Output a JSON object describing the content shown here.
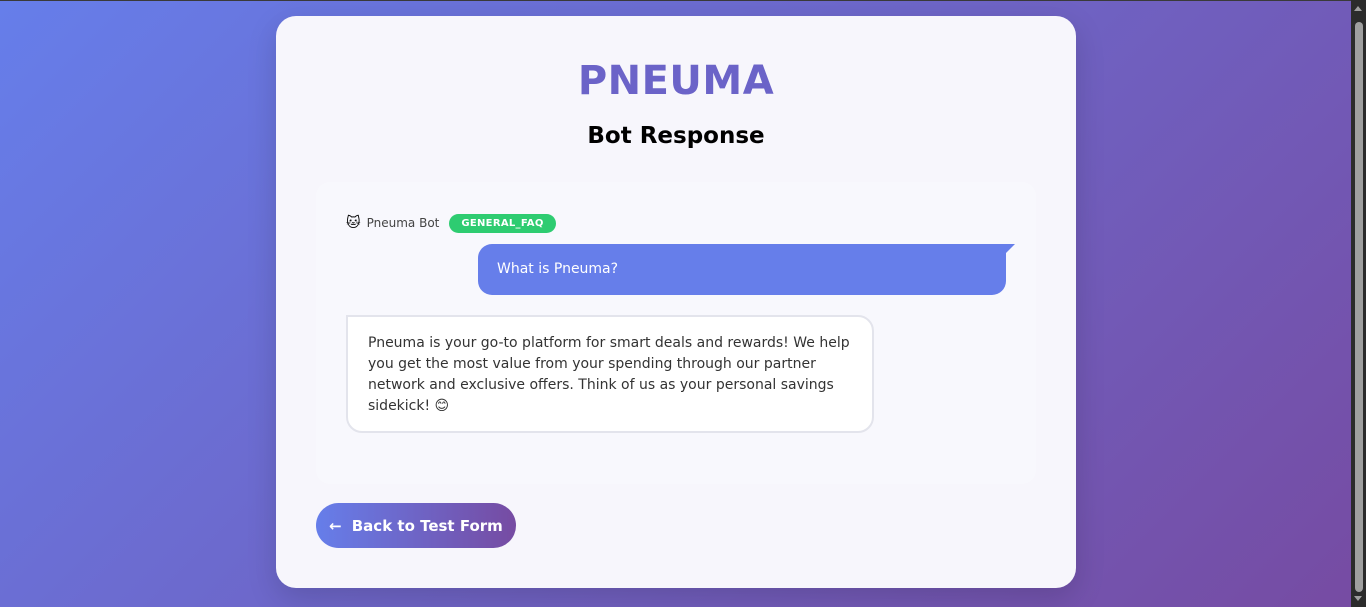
{
  "app": {
    "brand": "PNEUMA",
    "subtitle": "Bot Response"
  },
  "chat": {
    "bot_icon": "🐱",
    "bot_name": "Pneuma Bot",
    "intent": "GENERAL_FAQ",
    "user_message": "What is Pneuma?",
    "bot_message": "Pneuma is your go-to platform for smart deals and rewards! We help you get the most value from your spending through our partner network and exclusive offers. Think of us as your personal savings sidekick! 😊"
  },
  "actions": {
    "back_arrow": "←",
    "back_label": "Back to Test Form"
  },
  "colors": {
    "accent": "#667eea",
    "accent_end": "#764ba2",
    "brand": "#6b63c8",
    "badge": "#2ecc71"
  },
  "icons": {
    "bot": "bot-cat-icon",
    "back": "arrow-left-icon"
  }
}
